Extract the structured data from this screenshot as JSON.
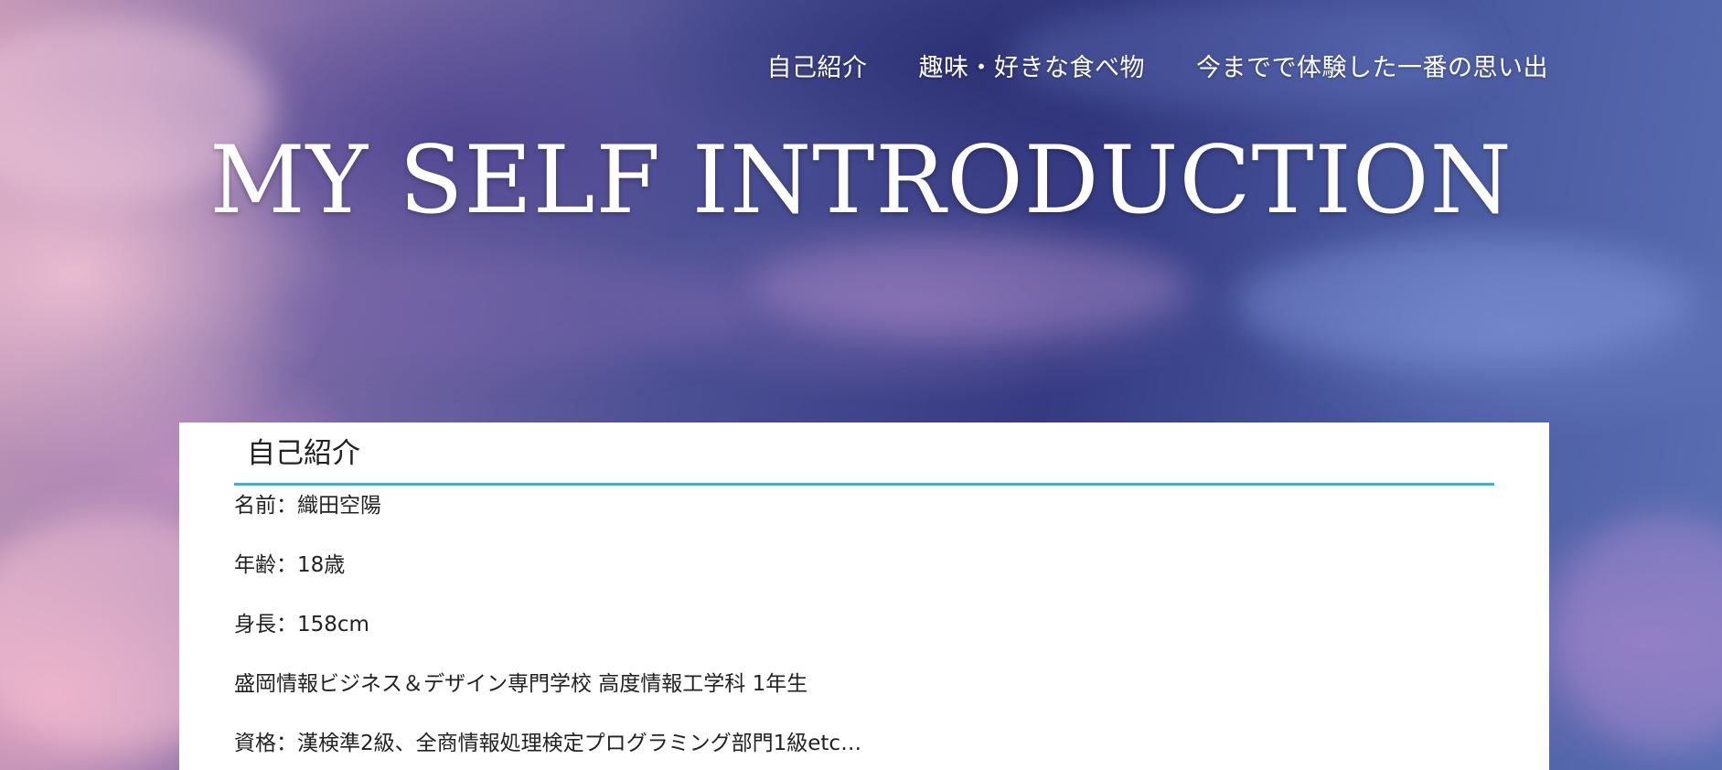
{
  "nav": {
    "items": [
      {
        "label": "自己紹介"
      },
      {
        "label": "趣味・好きな食べ物"
      },
      {
        "label": "今までで体験した一番の思い出"
      }
    ]
  },
  "hero": {
    "title": "MY SELF INTRODUCTION"
  },
  "profile": {
    "heading": "自己紹介",
    "accent_color": "#2bb8c8",
    "items": [
      {
        "text": "名前：織田空陽"
      },
      {
        "text": "年齢：18歳"
      },
      {
        "text": "身長：158cm"
      },
      {
        "text": "盛岡情報ビジネス＆デザイン専門学校 高度情報工学科 1年生"
      },
      {
        "text": "資格：漢検準2級、全商情報処理検定プログラミング部門1級etc…"
      }
    ]
  }
}
